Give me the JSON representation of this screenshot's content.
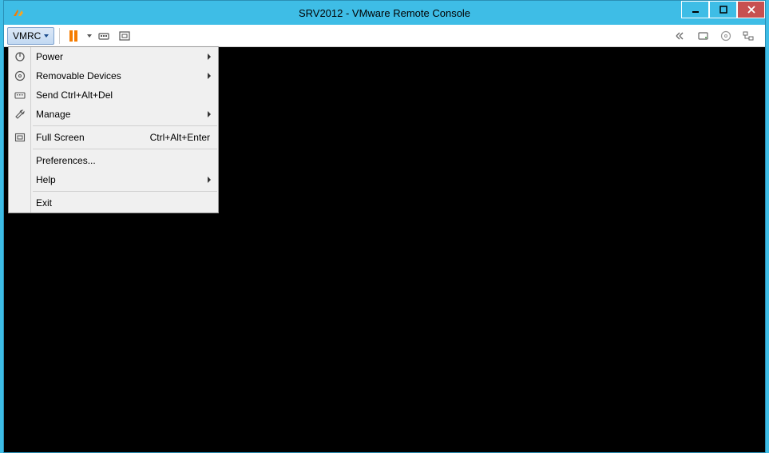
{
  "window": {
    "title": "SRV2012 - VMware Remote Console"
  },
  "toolbar": {
    "vmrc_label": "VMRC"
  },
  "menu": {
    "power": {
      "label": "Power"
    },
    "removable": {
      "label": "Removable Devices"
    },
    "sendcad": {
      "label": "Send Ctrl+Alt+Del"
    },
    "manage": {
      "label": "Manage"
    },
    "fullscreen": {
      "label": "Full Screen",
      "shortcut": "Ctrl+Alt+Enter"
    },
    "preferences": {
      "label": "Preferences..."
    },
    "help": {
      "label": "Help"
    },
    "exit": {
      "label": "Exit"
    }
  }
}
